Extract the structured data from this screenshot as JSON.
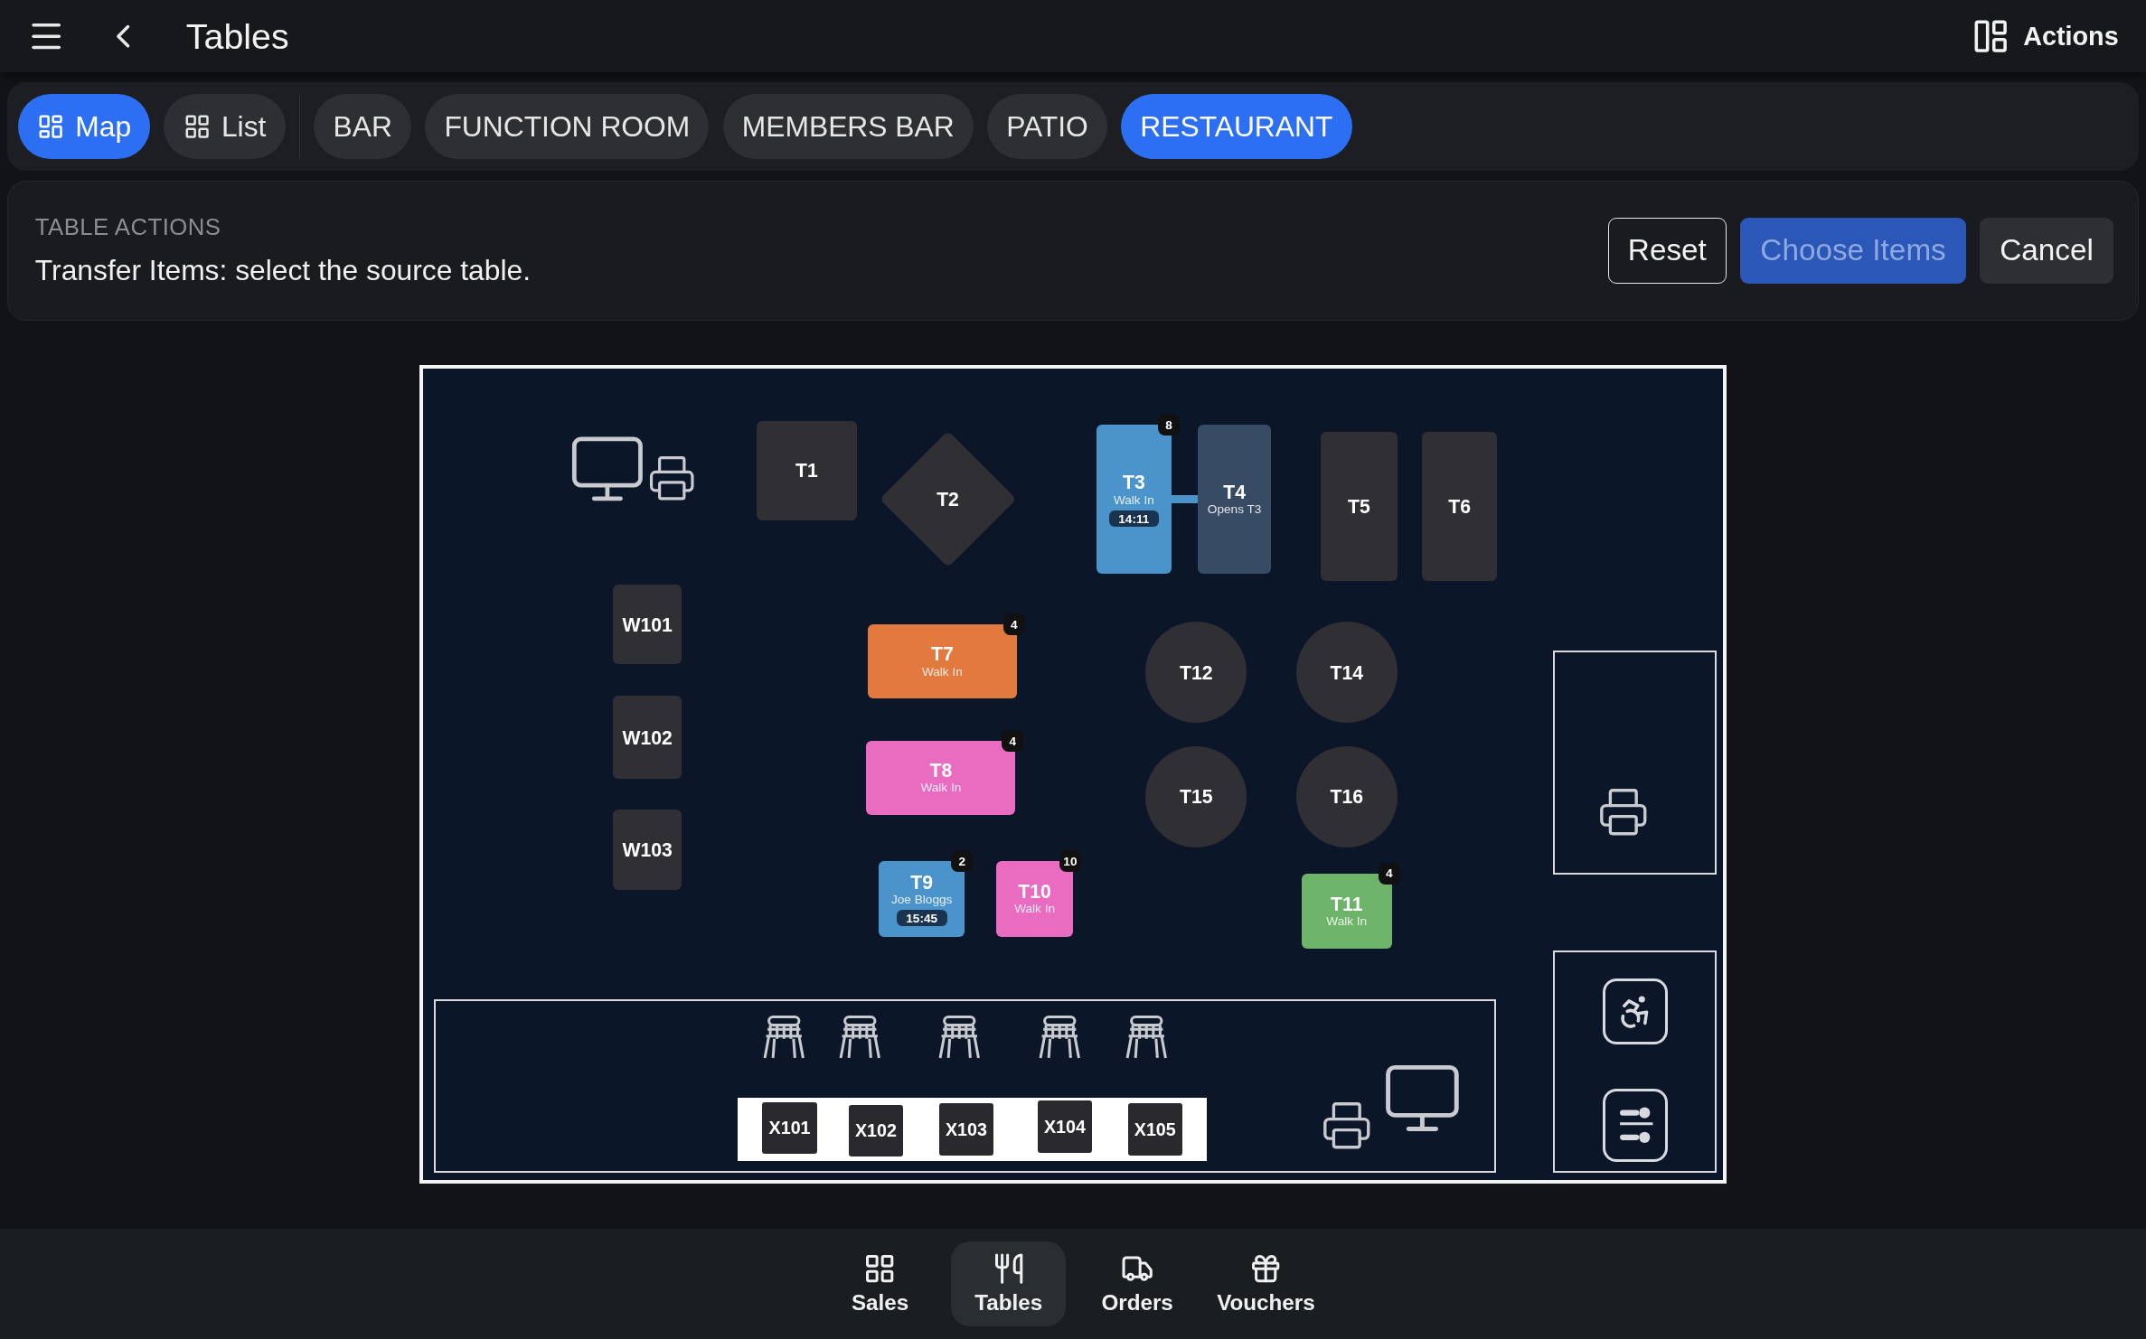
{
  "header": {
    "title": "Tables",
    "actions_label": "Actions"
  },
  "views": [
    {
      "label": "Map",
      "kind": "map",
      "selected": true
    },
    {
      "label": "List",
      "kind": "list",
      "selected": false
    }
  ],
  "areas": [
    {
      "label": "BAR",
      "selected": false
    },
    {
      "label": "FUNCTION ROOM",
      "selected": false
    },
    {
      "label": "MEMBERS BAR",
      "selected": false
    },
    {
      "label": "PATIO",
      "selected": false
    },
    {
      "label": "RESTAURANT",
      "selected": true
    }
  ],
  "table_actions": {
    "heading": "TABLE ACTIONS",
    "message": "Transfer Items: select the source table.",
    "buttons": [
      {
        "label": "Reset",
        "kind": "outline",
        "disabled": false
      },
      {
        "label": "Choose Items",
        "kind": "primary",
        "disabled": true
      },
      {
        "label": "Cancel",
        "kind": "secondary",
        "disabled": false
      }
    ]
  },
  "tables": [
    {
      "label": "T1",
      "kind": "square",
      "color": "#302f34"
    },
    {
      "label": "T2",
      "kind": "diamond",
      "color": "#302f34"
    },
    {
      "label": "T3",
      "kind": "rect",
      "color": "#4a93cb",
      "subtitle": "Walk In",
      "time": "14:11",
      "badge": "8"
    },
    {
      "label": "T4",
      "kind": "rect",
      "color": "#374b64",
      "subtitle": "Opens T3",
      "joined": true
    },
    {
      "label": "T5",
      "kind": "rect",
      "color": "#302f34"
    },
    {
      "label": "T6",
      "kind": "rect",
      "color": "#302f34"
    },
    {
      "label": "W101",
      "kind": "rect",
      "color": "#302f34"
    },
    {
      "label": "W102",
      "kind": "rect",
      "color": "#302f34"
    },
    {
      "label": "W103",
      "kind": "rect",
      "color": "#302f34"
    },
    {
      "label": "T7",
      "kind": "rect",
      "color": "#e27a40",
      "subtitle": "Walk In",
      "badge": "4"
    },
    {
      "label": "T8",
      "kind": "rect",
      "color": "#ea6cc0",
      "subtitle": "Walk In",
      "badge": "4"
    },
    {
      "label": "T9",
      "kind": "rect",
      "color": "#4a93cb",
      "subtitle": "Joe Bloggs",
      "time": "15:45",
      "badge": "2"
    },
    {
      "label": "T10",
      "kind": "rect",
      "color": "#ea6cc0",
      "subtitle": "Walk In",
      "badge": "10"
    },
    {
      "label": "T11",
      "kind": "rect",
      "color": "#6db46a",
      "subtitle": "Walk In",
      "badge": "4"
    },
    {
      "label": "T12",
      "kind": "round",
      "color": "#302f34"
    },
    {
      "label": "T14",
      "kind": "round",
      "color": "#302f34"
    },
    {
      "label": "T15",
      "kind": "round",
      "color": "#302f34"
    },
    {
      "label": "T16",
      "kind": "round",
      "color": "#302f34"
    }
  ],
  "bar_seats": [
    {
      "label": "X101"
    },
    {
      "label": "X102"
    },
    {
      "label": "X103"
    },
    {
      "label": "X104"
    },
    {
      "label": "X105"
    }
  ],
  "bottom_nav": [
    {
      "label": "Sales",
      "kind": "sales",
      "selected": false
    },
    {
      "label": "Tables",
      "kind": "tables",
      "selected": true
    },
    {
      "label": "Orders",
      "kind": "orders",
      "selected": false
    },
    {
      "label": "Vouchers",
      "kind": "vouchers",
      "selected": false
    }
  ]
}
